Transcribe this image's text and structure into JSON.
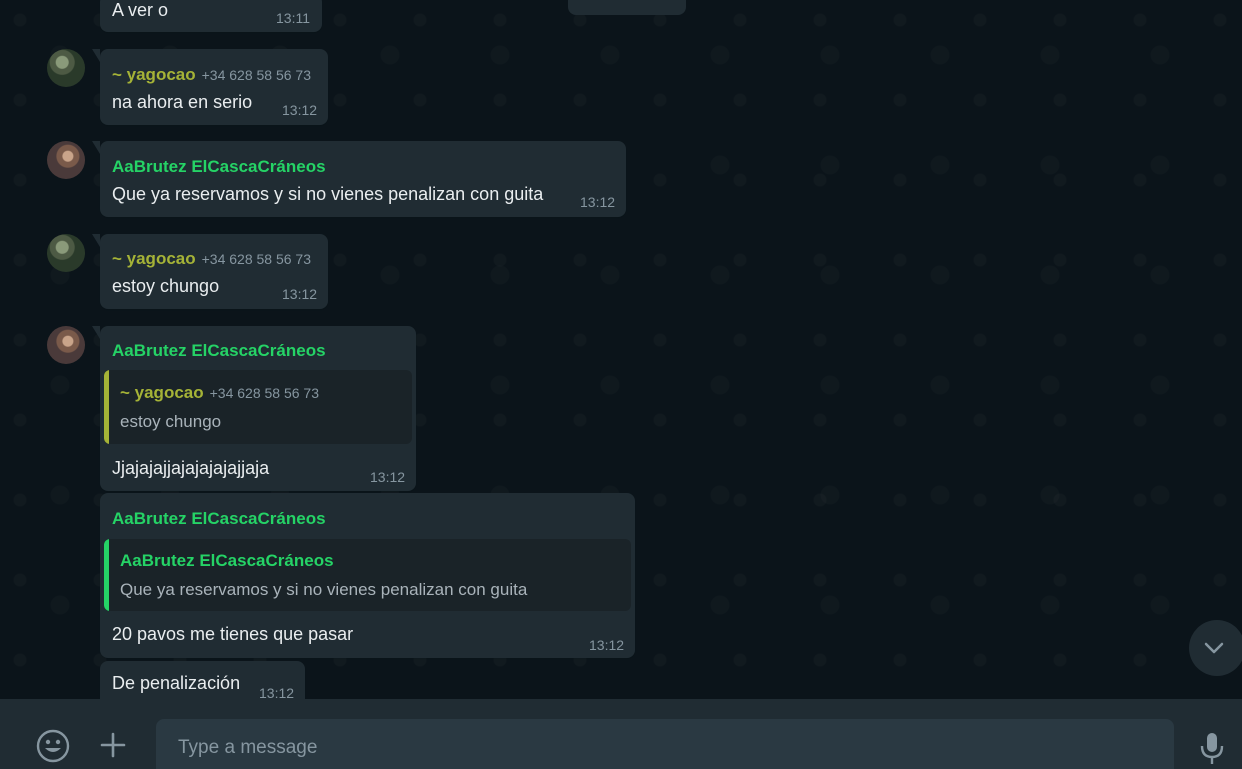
{
  "messages": [
    {
      "text": "A ver o",
      "time": "13:11"
    },
    {
      "sender": "~ yagocao",
      "phone": "+34 628 58 56 73",
      "text": "na ahora en serio",
      "time": "13:12"
    },
    {
      "sender": "AaBrutez ElCascaCráneos",
      "text": "Que ya reservamos y si no vienes penalizan con guita",
      "time": "13:12"
    },
    {
      "sender": "~ yagocao",
      "phone": "+34 628 58 56 73",
      "text": "estoy chungo",
      "time": "13:12"
    },
    {
      "sender": "AaBrutez ElCascaCráneos",
      "quote": {
        "sender": "~ yagocao",
        "phone": "+34 628 58 56 73",
        "text": "estoy chungo"
      },
      "text": "Jjajajajjajajajajajjaja",
      "time": "13:12"
    },
    {
      "sender": "AaBrutez ElCascaCráneos",
      "quote": {
        "sender": "AaBrutez ElCascaCráneos",
        "text": "Que ya reservamos y si no vienes penalizan con guita"
      },
      "text": "20 pavos me tienes que pasar",
      "time": "13:12"
    },
    {
      "text": "De penalización",
      "time": "13:12"
    }
  ],
  "composer": {
    "placeholder": "Type a message",
    "emoji_icon": "emoji-icon",
    "attach_icon": "plus-icon",
    "mic_icon": "microphone-icon"
  },
  "scroll_icon": "chevron-down-icon",
  "colors": {
    "background": "#0b141a",
    "bubble": "#202c33",
    "sender_yellow": "#a5b337",
    "sender_green": "#25d366",
    "meta_gray": "#8696a0"
  }
}
